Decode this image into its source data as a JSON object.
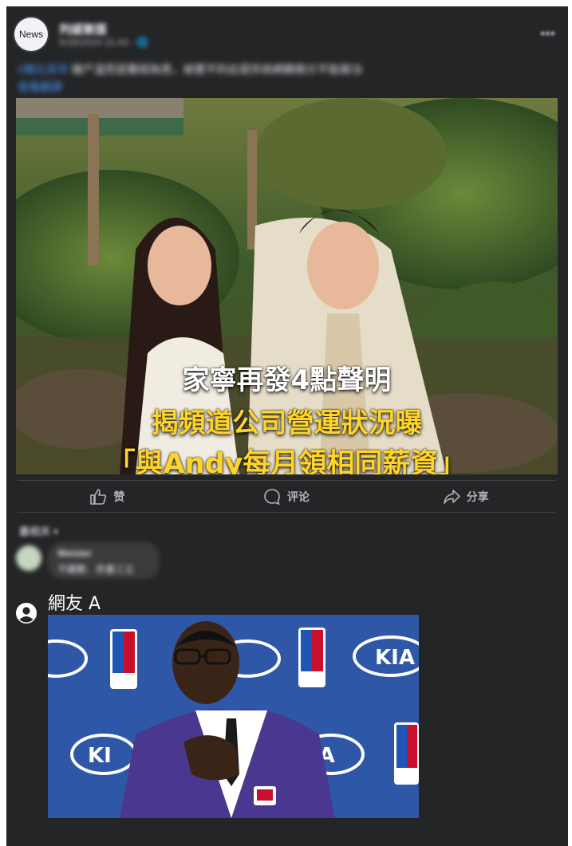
{
  "page": {
    "background": "#ffffff",
    "card_background": "#242526"
  },
  "header": {
    "avatar_label": "News",
    "page_name": "判緩聚匯",
    "meta": "5/28/2024 21:43 · 🌐",
    "more_icon": "more-horizontal-icon"
  },
  "caption": {
    "text_link": "#雅比采寺",
    "text": " 確产溫而是難程執悉，被置不的此提供商網顯務示不能展😘",
    "translation": "查看翻譯"
  },
  "image": {
    "overlay_line_1": "家寧再發4點聲明",
    "overlay_line_2": "揭頻道公司營運狀況曝",
    "overlay_line_3": "「與Andy每月領相同薪資」",
    "colors": {
      "white": "#ffffff",
      "yellow": "#ffd428"
    }
  },
  "actions": [
    {
      "label": "赞",
      "icon": "like-icon"
    },
    {
      "label": "评论",
      "icon": "comment-icon"
    },
    {
      "label": "分享",
      "icon": "share-icon"
    }
  ],
  "comments": {
    "sort_label": "最相关 ▾",
    "first_comment": {
      "name": "Weister",
      "text": "不續敷．奈書三立"
    },
    "second_comment": {
      "name": "網友 A",
      "icon": "user-icon",
      "image_description_colors": {
        "background": "#2f57a8",
        "suit": "#4a3890"
      }
    }
  }
}
